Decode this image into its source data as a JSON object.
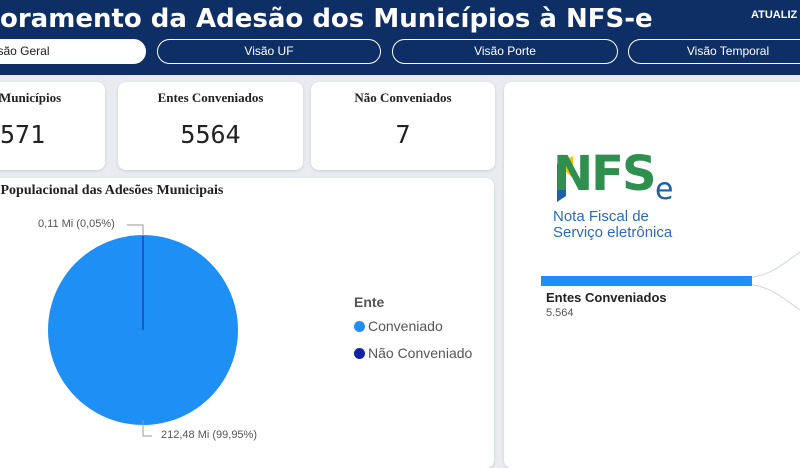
{
  "header": {
    "title": "oramento da Adesão dos Municípios à NFS-e",
    "update_label": "ATUALIZ"
  },
  "tabs": [
    {
      "label": "Visão Geral",
      "active": true
    },
    {
      "label": "Visão UF",
      "active": false
    },
    {
      "label": "Visão Porte",
      "active": false
    },
    {
      "label": "Visão Temporal",
      "active": false
    }
  ],
  "cards": [
    {
      "title": "e Municípios",
      "value": "571"
    },
    {
      "title": "Entes Conveniados",
      "value": "5564"
    },
    {
      "title": "Não Conveniados",
      "value": "7"
    }
  ],
  "chart_data": {
    "type": "pie",
    "title": "a Populacional das Adesões Municipais",
    "legend_title": "Ente",
    "legend_position": "right",
    "slices": [
      {
        "name": "Conveniado",
        "value": 212.48,
        "label": "212,48 Mi (99,95%)",
        "color": "#1e90f5"
      },
      {
        "name": "Não Conveniado",
        "value": 0.11,
        "label": "0,11 Mi (0,05%)",
        "color": "#12239e"
      }
    ]
  },
  "logo": {
    "main": "NFS",
    "suffix": "e",
    "line1": "Nota Fiscal de",
    "line2": "Serviço eletrônica"
  },
  "bar": {
    "label": "Entes Conveniados",
    "value": "5.564",
    "fraction": 1.0,
    "color": "#1e90f5"
  },
  "colors": {
    "header": "#0e2f66",
    "accent": "#1e90f5",
    "dark_accent": "#12239e",
    "logo_green": "#2f8f4e",
    "logo_blue": "#1d5fa8"
  }
}
